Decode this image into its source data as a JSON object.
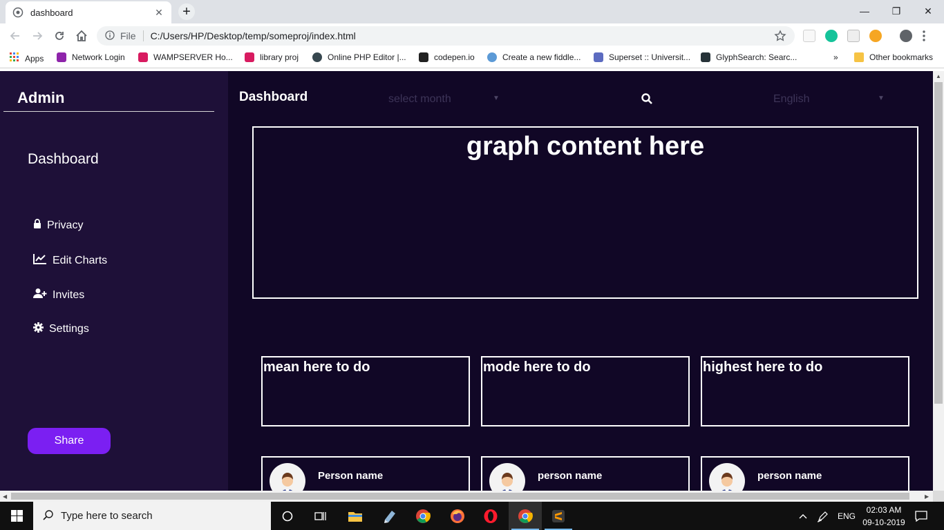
{
  "browser": {
    "tab_title": "dashboard",
    "tab_close": "✕",
    "new_tab": "+",
    "window_controls": {
      "minimize": "—",
      "restore": "❐",
      "close": "✕"
    },
    "address": {
      "scheme_label": "File",
      "url": "C:/Users/HP/Desktop/temp/someproj/index.html"
    },
    "bookmarks": [
      {
        "label": "Apps",
        "color": "#e53935"
      },
      {
        "label": "Network Login",
        "color": "#8e24aa"
      },
      {
        "label": "WAMPSERVER Ho...",
        "color": "#d81b60"
      },
      {
        "label": "library proj",
        "color": "#d81b60"
      },
      {
        "label": "Online PHP Editor |...",
        "color": "#37474f"
      },
      {
        "label": "codepen.io",
        "color": "#212121"
      },
      {
        "label": "Create a new fiddle...",
        "color": "#5c9ad6"
      },
      {
        "label": "Superset :: Universit...",
        "color": "#5c6bc0"
      },
      {
        "label": "GlyphSearch: Searc...",
        "color": "#263238"
      }
    ],
    "bookmarks_overflow": "»",
    "other_bookmarks": "Other bookmarks"
  },
  "sidebar": {
    "title": "Admin",
    "section": "Dashboard",
    "items": [
      {
        "label": "Privacy",
        "icon": "lock-icon"
      },
      {
        "label": "Edit Charts",
        "icon": "chart-line-icon"
      },
      {
        "label": "Invites",
        "icon": "user-plus-icon"
      },
      {
        "label": "Settings",
        "icon": "gear-icon"
      }
    ],
    "share_label": "Share"
  },
  "header": {
    "title": "Dashboard",
    "month_select": "select month",
    "language_select": "English"
  },
  "graph": {
    "title": "graph content here"
  },
  "stats": [
    {
      "label": "mean here to do"
    },
    {
      "label": "mode here to do"
    },
    {
      "label": "highest here to do"
    }
  ],
  "people": [
    {
      "name": "Person name"
    },
    {
      "name": "person name"
    },
    {
      "name": "person name"
    }
  ],
  "taskbar": {
    "search_placeholder": "Type here to search",
    "language": "ENG",
    "time": "02:03 AM",
    "date": "09-10-2019"
  },
  "colors": {
    "page_bg": "#110726",
    "sidebar_bg": "#1e1038",
    "accent": "#7b1ff2"
  }
}
